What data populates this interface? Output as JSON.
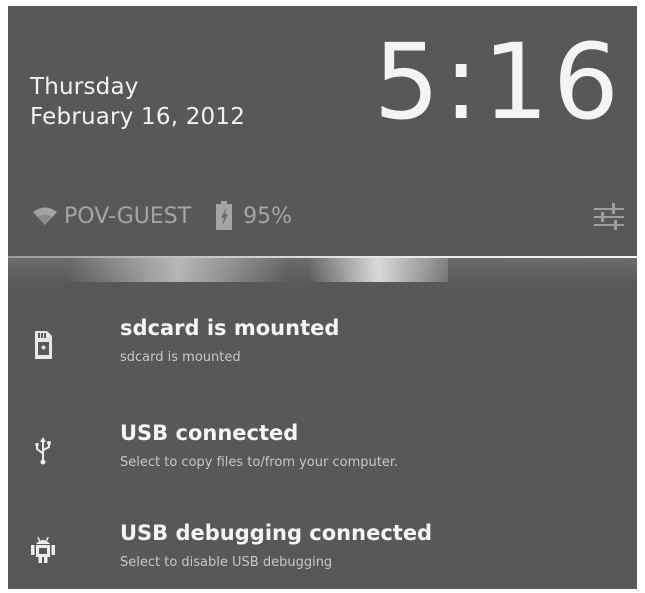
{
  "header": {
    "day": "Thursday",
    "date": "February 16, 2012",
    "time_hours": "5",
    "time_separator": ":",
    "time_minutes": "16"
  },
  "status": {
    "network_name": "POV-GUEST",
    "battery_percent": "95%",
    "wifi_icon": "wifi-icon",
    "battery_icon": "battery-icon",
    "settings_icon": "settings-sliders-icon"
  },
  "notifications": [
    {
      "title": "sdcard is mounted",
      "subtitle": "sdcard is mounted",
      "icon": "sdcard-icon"
    },
    {
      "title": "USB connected",
      "subtitle": "Select to copy files to/from your computer.",
      "icon": "usb-icon"
    },
    {
      "title": "USB debugging connected",
      "subtitle": "Select to disable USB debugging",
      "icon": "android-icon"
    }
  ]
}
